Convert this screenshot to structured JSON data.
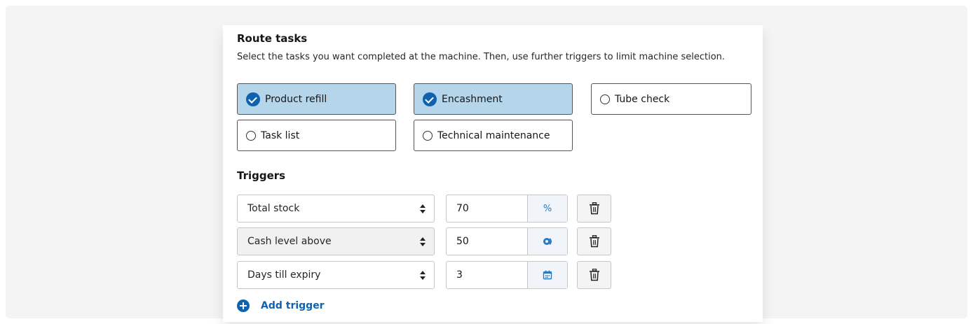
{
  "route_tasks": {
    "title": "Route tasks",
    "description": "Select the tasks you want completed at the machine. Then, use further triggers to limit machine selection.",
    "tasks": [
      {
        "label": "Product refill",
        "checked": true
      },
      {
        "label": "Encashment",
        "checked": true
      },
      {
        "label": "Tube check",
        "checked": false
      },
      {
        "label": "Task list",
        "checked": false
      },
      {
        "label": "Technical maintenance",
        "checked": false
      }
    ]
  },
  "triggers": {
    "title": "Triggers",
    "rows": [
      {
        "type": "Total stock",
        "value": "70",
        "unit": "%",
        "unit_icon": "percent"
      },
      {
        "type": "Cash level above",
        "value": "50",
        "unit": "",
        "unit_icon": "coins-icon"
      },
      {
        "type": "Days till expiry",
        "value": "3",
        "unit": "",
        "unit_icon": "calendar-icon"
      }
    ],
    "add_label": "Add trigger"
  },
  "colors": {
    "accent": "#0f62b0",
    "selected_bg": "#b5d5eb"
  }
}
